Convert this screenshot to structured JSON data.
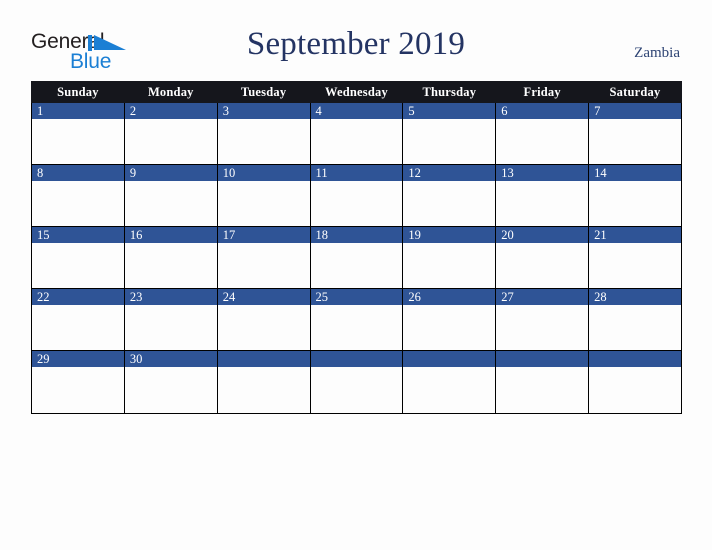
{
  "brand": {
    "name_part1": "General",
    "name_part2": "Blue",
    "mark": "triangle-logo-icon",
    "color_dark": "#231f20",
    "color_blue": "#1b7fd4"
  },
  "header": {
    "title": "September 2019",
    "region": "Zambia",
    "title_color": "#243463",
    "region_color": "#2d4373"
  },
  "calendar": {
    "month": "September",
    "year": "2019",
    "header_bg": "#15161c",
    "daynum_bg": "#2f5496",
    "cell_bg": "#fdfdfd",
    "border_color": "#000000",
    "weekday_headers": [
      "Sunday",
      "Monday",
      "Tuesday",
      "Wednesday",
      "Thursday",
      "Friday",
      "Saturday"
    ],
    "weeks": [
      {
        "days": [
          {
            "num": "1"
          },
          {
            "num": "2"
          },
          {
            "num": "3"
          },
          {
            "num": "4"
          },
          {
            "num": "5"
          },
          {
            "num": "6"
          },
          {
            "num": "7"
          }
        ]
      },
      {
        "days": [
          {
            "num": "8"
          },
          {
            "num": "9"
          },
          {
            "num": "10"
          },
          {
            "num": "11"
          },
          {
            "num": "12"
          },
          {
            "num": "13"
          },
          {
            "num": "14"
          }
        ]
      },
      {
        "days": [
          {
            "num": "15"
          },
          {
            "num": "16"
          },
          {
            "num": "17"
          },
          {
            "num": "18"
          },
          {
            "num": "19"
          },
          {
            "num": "20"
          },
          {
            "num": "21"
          }
        ]
      },
      {
        "days": [
          {
            "num": "22"
          },
          {
            "num": "23"
          },
          {
            "num": "24"
          },
          {
            "num": "25"
          },
          {
            "num": "26"
          },
          {
            "num": "27"
          },
          {
            "num": "28"
          }
        ]
      },
      {
        "days": [
          {
            "num": "29"
          },
          {
            "num": "30"
          },
          {
            "num": ""
          },
          {
            "num": ""
          },
          {
            "num": ""
          },
          {
            "num": ""
          },
          {
            "num": ""
          }
        ]
      }
    ]
  }
}
